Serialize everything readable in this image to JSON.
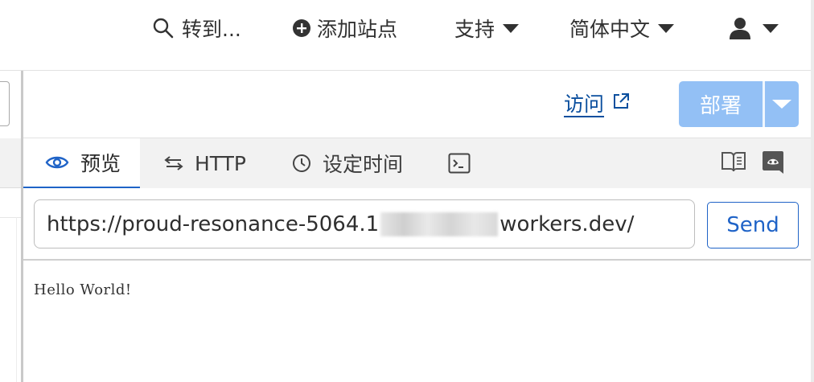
{
  "topnav": {
    "goto_label": "转到...",
    "add_site_label": "添加站点",
    "support_label": "支持",
    "language_label": "简体中文",
    "account_icon": "user-icon"
  },
  "toolbar": {
    "visit_label": "访问",
    "deploy_label": "部署"
  },
  "tabs": [
    {
      "label": "预览",
      "icon": "eye-icon",
      "active": true
    },
    {
      "label": "HTTP",
      "icon": "swap-arrows-icon",
      "active": false
    },
    {
      "label": "设定时间",
      "icon": "clock-icon",
      "active": false
    },
    {
      "label": "",
      "icon": "terminal-icon",
      "active": false
    }
  ],
  "tab_actions": [
    "book-icon",
    "discord-icon"
  ],
  "url": {
    "prefix": "https://proud-resonance-5064.1",
    "suffix": "workers.dev/"
  },
  "send_label": "Send",
  "response_text": "Hello World!",
  "colors": {
    "accent": "#1f63c7",
    "deploy_bg": "#93c0f5",
    "link": "#0b4f9e",
    "tabbar_bg": "#f2f2f2"
  }
}
